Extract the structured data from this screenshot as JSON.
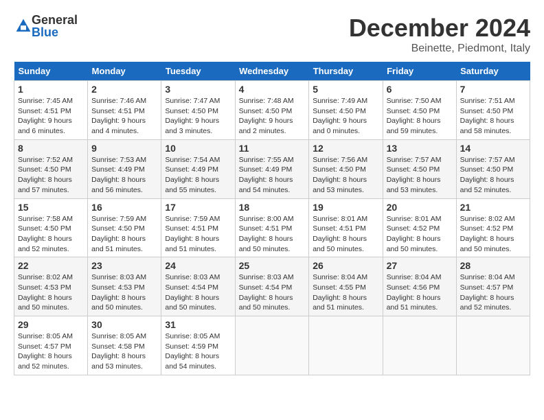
{
  "header": {
    "logo_general": "General",
    "logo_blue": "Blue",
    "title": "December 2024",
    "location": "Beinette, Piedmont, Italy"
  },
  "calendar": {
    "days_of_week": [
      "Sunday",
      "Monday",
      "Tuesday",
      "Wednesday",
      "Thursday",
      "Friday",
      "Saturday"
    ],
    "weeks": [
      [
        null,
        null,
        null,
        null,
        null,
        null,
        null
      ]
    ],
    "cells": [
      {
        "day": "1",
        "sunrise": "7:45 AM",
        "sunset": "4:51 PM",
        "daylight": "9 hours and 6 minutes."
      },
      {
        "day": "2",
        "sunrise": "7:46 AM",
        "sunset": "4:51 PM",
        "daylight": "9 hours and 4 minutes."
      },
      {
        "day": "3",
        "sunrise": "7:47 AM",
        "sunset": "4:50 PM",
        "daylight": "9 hours and 3 minutes."
      },
      {
        "day": "4",
        "sunrise": "7:48 AM",
        "sunset": "4:50 PM",
        "daylight": "9 hours and 2 minutes."
      },
      {
        "day": "5",
        "sunrise": "7:49 AM",
        "sunset": "4:50 PM",
        "daylight": "9 hours and 0 minutes."
      },
      {
        "day": "6",
        "sunrise": "7:50 AM",
        "sunset": "4:50 PM",
        "daylight": "8 hours and 59 minutes."
      },
      {
        "day": "7",
        "sunrise": "7:51 AM",
        "sunset": "4:50 PM",
        "daylight": "8 hours and 58 minutes."
      },
      {
        "day": "8",
        "sunrise": "7:52 AM",
        "sunset": "4:50 PM",
        "daylight": "8 hours and 57 minutes."
      },
      {
        "day": "9",
        "sunrise": "7:53 AM",
        "sunset": "4:49 PM",
        "daylight": "8 hours and 56 minutes."
      },
      {
        "day": "10",
        "sunrise": "7:54 AM",
        "sunset": "4:49 PM",
        "daylight": "8 hours and 55 minutes."
      },
      {
        "day": "11",
        "sunrise": "7:55 AM",
        "sunset": "4:49 PM",
        "daylight": "8 hours and 54 minutes."
      },
      {
        "day": "12",
        "sunrise": "7:56 AM",
        "sunset": "4:50 PM",
        "daylight": "8 hours and 53 minutes."
      },
      {
        "day": "13",
        "sunrise": "7:57 AM",
        "sunset": "4:50 PM",
        "daylight": "8 hours and 53 minutes."
      },
      {
        "day": "14",
        "sunrise": "7:57 AM",
        "sunset": "4:50 PM",
        "daylight": "8 hours and 52 minutes."
      },
      {
        "day": "15",
        "sunrise": "7:58 AM",
        "sunset": "4:50 PM",
        "daylight": "8 hours and 52 minutes."
      },
      {
        "day": "16",
        "sunrise": "7:59 AM",
        "sunset": "4:50 PM",
        "daylight": "8 hours and 51 minutes."
      },
      {
        "day": "17",
        "sunrise": "7:59 AM",
        "sunset": "4:51 PM",
        "daylight": "8 hours and 51 minutes."
      },
      {
        "day": "18",
        "sunrise": "8:00 AM",
        "sunset": "4:51 PM",
        "daylight": "8 hours and 50 minutes."
      },
      {
        "day": "19",
        "sunrise": "8:01 AM",
        "sunset": "4:51 PM",
        "daylight": "8 hours and 50 minutes."
      },
      {
        "day": "20",
        "sunrise": "8:01 AM",
        "sunset": "4:52 PM",
        "daylight": "8 hours and 50 minutes."
      },
      {
        "day": "21",
        "sunrise": "8:02 AM",
        "sunset": "4:52 PM",
        "daylight": "8 hours and 50 minutes."
      },
      {
        "day": "22",
        "sunrise": "8:02 AM",
        "sunset": "4:53 PM",
        "daylight": "8 hours and 50 minutes."
      },
      {
        "day": "23",
        "sunrise": "8:03 AM",
        "sunset": "4:53 PM",
        "daylight": "8 hours and 50 minutes."
      },
      {
        "day": "24",
        "sunrise": "8:03 AM",
        "sunset": "4:54 PM",
        "daylight": "8 hours and 50 minutes."
      },
      {
        "day": "25",
        "sunrise": "8:03 AM",
        "sunset": "4:54 PM",
        "daylight": "8 hours and 50 minutes."
      },
      {
        "day": "26",
        "sunrise": "8:04 AM",
        "sunset": "4:55 PM",
        "daylight": "8 hours and 51 minutes."
      },
      {
        "day": "27",
        "sunrise": "8:04 AM",
        "sunset": "4:56 PM",
        "daylight": "8 hours and 51 minutes."
      },
      {
        "day": "28",
        "sunrise": "8:04 AM",
        "sunset": "4:57 PM",
        "daylight": "8 hours and 52 minutes."
      },
      {
        "day": "29",
        "sunrise": "8:05 AM",
        "sunset": "4:57 PM",
        "daylight": "8 hours and 52 minutes."
      },
      {
        "day": "30",
        "sunrise": "8:05 AM",
        "sunset": "4:58 PM",
        "daylight": "8 hours and 53 minutes."
      },
      {
        "day": "31",
        "sunrise": "8:05 AM",
        "sunset": "4:59 PM",
        "daylight": "8 hours and 54 minutes."
      }
    ]
  }
}
